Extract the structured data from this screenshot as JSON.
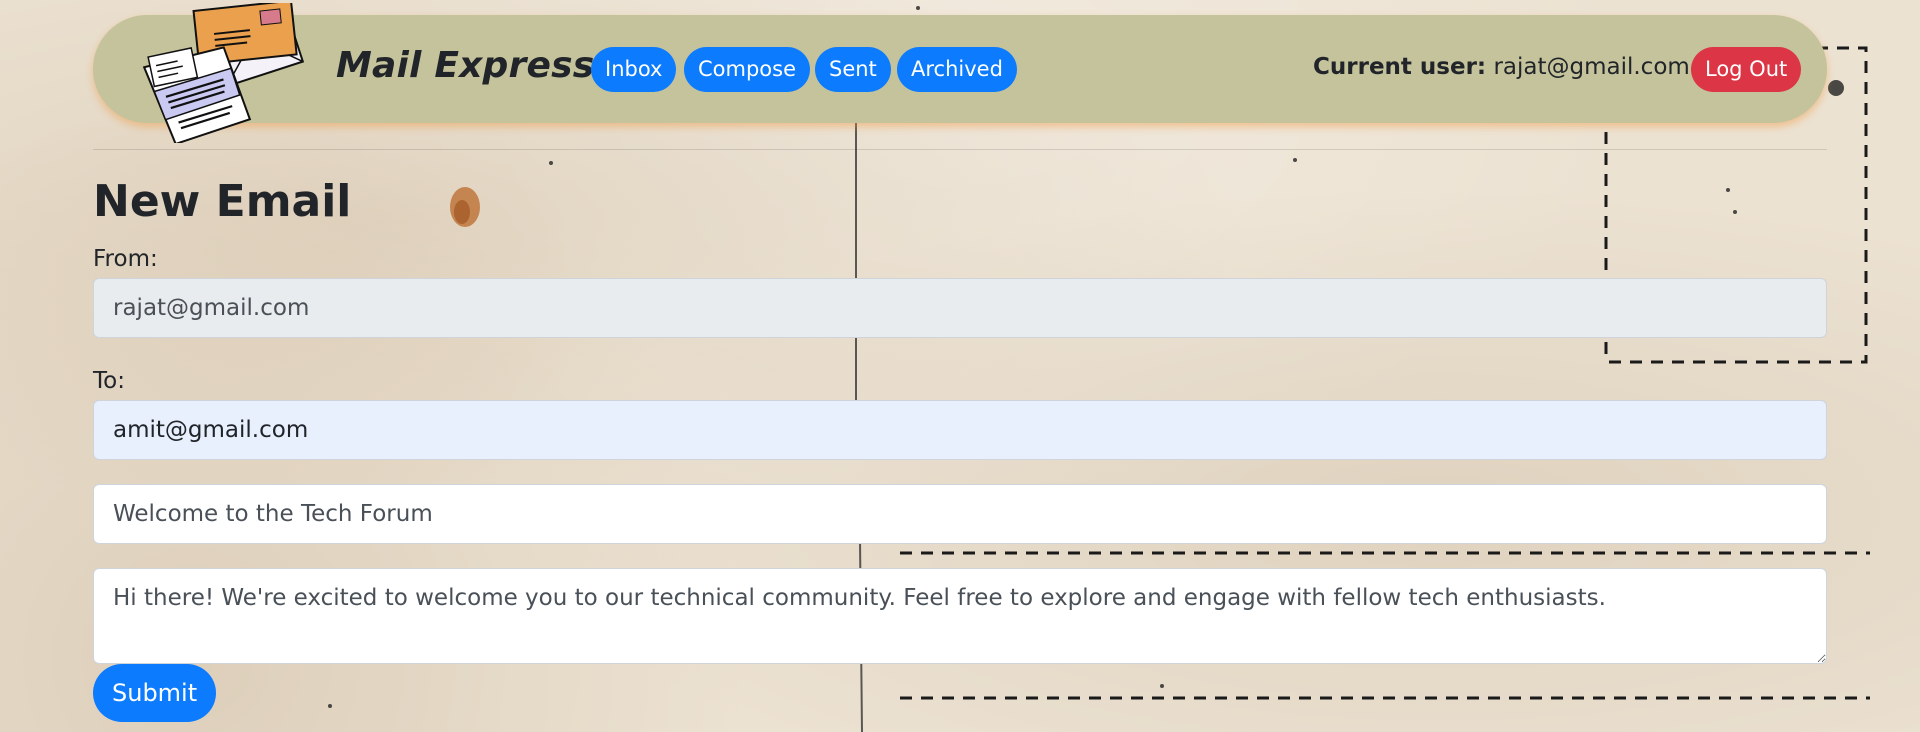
{
  "app": {
    "brand": "Mail Express"
  },
  "nav": {
    "inbox": "Inbox",
    "compose": "Compose",
    "sent": "Sent",
    "archived": "Archived"
  },
  "user": {
    "label": "Current user:",
    "email": "rajat@gmail.com",
    "logout": "Log Out"
  },
  "page": {
    "title": "New Email"
  },
  "form": {
    "from_label": "From:",
    "from_value": "rajat@gmail.com",
    "to_label": "To:",
    "to_value": "amit@gmail.com",
    "subject_value": "Welcome to the Tech Forum",
    "body_value": "Hi there! We're excited to welcome you to our technical community. Feel free to explore and engage with fellow tech enthusiasts.",
    "submit": "Submit"
  },
  "colors": {
    "navbar": "#c5c39c",
    "primary": "#0d7bfd",
    "danger": "#dc3545",
    "background": "#ece2d2"
  },
  "icons": {
    "logo": "envelopes-letter-icon"
  }
}
